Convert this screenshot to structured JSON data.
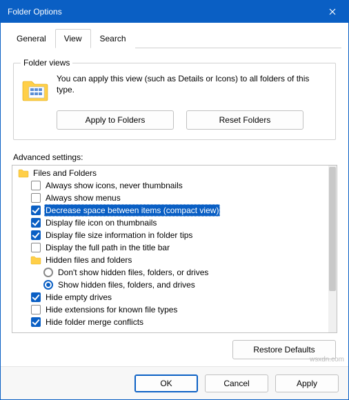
{
  "window": {
    "title": "Folder Options"
  },
  "tabs": {
    "general": "General",
    "view": "View",
    "search": "Search",
    "active": "view"
  },
  "folderViews": {
    "legend": "Folder views",
    "desc": "You can apply this view (such as Details or Icons) to all folders of this type.",
    "applyBtn": "Apply to Folders",
    "resetBtn": "Reset Folders"
  },
  "advLabel": "Advanced settings:",
  "tree": {
    "root": "Files and Folders",
    "items": [
      {
        "type": "checkbox",
        "checked": false,
        "label": "Always show icons, never thumbnails"
      },
      {
        "type": "checkbox",
        "checked": false,
        "label": "Always show menus"
      },
      {
        "type": "checkbox",
        "checked": true,
        "label": "Decrease space between items (compact view)",
        "selected": true
      },
      {
        "type": "checkbox",
        "checked": true,
        "label": "Display file icon on thumbnails"
      },
      {
        "type": "checkbox",
        "checked": true,
        "label": "Display file size information in folder tips"
      },
      {
        "type": "checkbox",
        "checked": false,
        "label": "Display the full path in the title bar"
      }
    ],
    "subfolder": "Hidden files and folders",
    "radios": [
      {
        "type": "radio",
        "checked": false,
        "label": "Don't show hidden files, folders, or drives"
      },
      {
        "type": "radio",
        "checked": true,
        "label": "Show hidden files, folders, and drives"
      }
    ],
    "items2": [
      {
        "type": "checkbox",
        "checked": true,
        "label": "Hide empty drives"
      },
      {
        "type": "checkbox",
        "checked": false,
        "label": "Hide extensions for known file types"
      },
      {
        "type": "checkbox",
        "checked": true,
        "label": "Hide folder merge conflicts"
      }
    ]
  },
  "restoreBtn": "Restore Defaults",
  "footer": {
    "ok": "OK",
    "cancel": "Cancel",
    "apply": "Apply"
  },
  "watermark": "wsxdn.com"
}
